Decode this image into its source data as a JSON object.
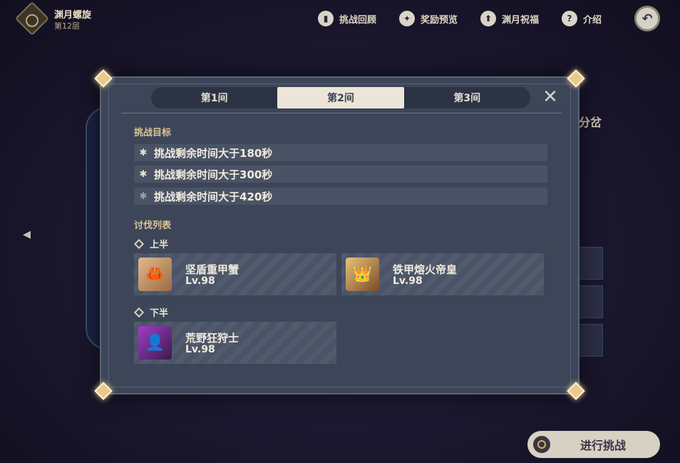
{
  "topbar": {
    "floor_title": "渊月螺旋",
    "floor_subtitle": "第12层",
    "nav": [
      {
        "label": "挑战回顾",
        "icon": "book-icon",
        "glyph": "▮"
      },
      {
        "label": "奖励预览",
        "icon": "star-icon",
        "glyph": "✦"
      },
      {
        "label": "渊月祝福",
        "icon": "upload-icon",
        "glyph": "⬆"
      },
      {
        "label": "介绍",
        "icon": "help-icon",
        "glyph": "?"
      }
    ],
    "back_glyph": "↶"
  },
  "background": {
    "side_text": "分岔",
    "left_arrow": "◂"
  },
  "dialog": {
    "tabs": [
      "第1间",
      "第2间",
      "第3间"
    ],
    "active_tab": 1,
    "close_glyph": "✕",
    "goals_title": "挑战目标",
    "goals": [
      {
        "text": "挑战剩余时间大于180秒",
        "achieved": true
      },
      {
        "text": "挑战剩余时间大于300秒",
        "achieved": true
      },
      {
        "text": "挑战剩余时间大于420秒",
        "achieved": false
      }
    ],
    "enemies_title": "讨伐列表",
    "first_half_label": "上半",
    "second_half_label": "下半",
    "first_half_enemies": [
      {
        "name": "坚盾重甲蟹",
        "level": "Lv.98"
      },
      {
        "name": "铁甲熔火帝皇",
        "level": "Lv.98"
      }
    ],
    "second_half_enemies": [
      {
        "name": "荒野狂狩士",
        "level": "Lv.98"
      }
    ]
  },
  "challenge_button": {
    "label": "进行挑战"
  },
  "colors": {
    "accent_gold": "#d9c596",
    "panel": "#3d4658",
    "tab_active": "#ece5d8"
  }
}
